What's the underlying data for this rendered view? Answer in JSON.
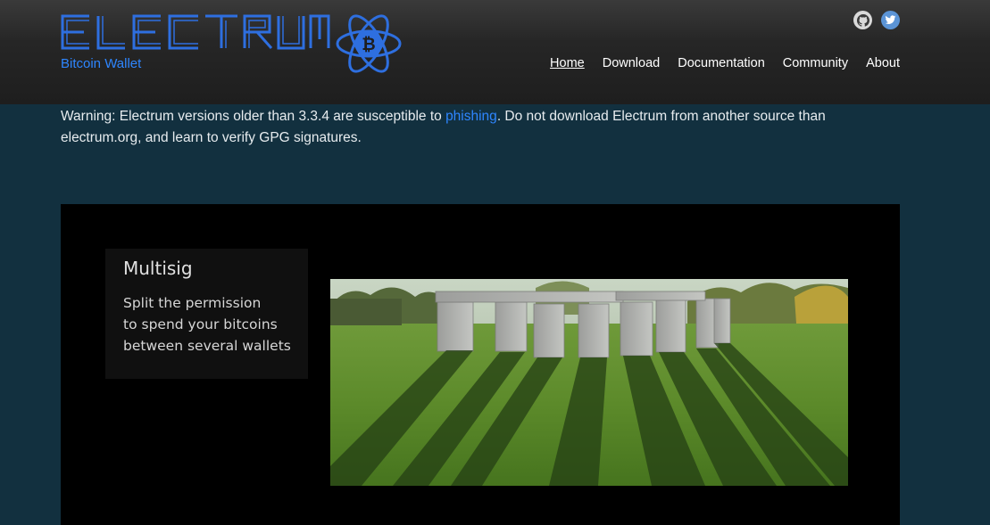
{
  "brand": {
    "tagline": "Bitcoin Wallet",
    "accent_color": "#2e86ff",
    "logo_icon": "bitcoin-atom-icon"
  },
  "social": {
    "github_icon": "github-icon",
    "twitter_icon": "twitter-icon"
  },
  "nav": {
    "items": [
      {
        "label": "Home"
      },
      {
        "label": "Download"
      },
      {
        "label": "Documentation"
      },
      {
        "label": "Community"
      },
      {
        "label": "About"
      }
    ]
  },
  "warning": {
    "before": "Warning: Electrum versions older than 3.3.4 are susceptible to ",
    "link": "phishing",
    "after": ". Do not download Electrum from another source than electrum.org, and learn to verify GPG signatures."
  },
  "feature": {
    "title": "Multisig",
    "lines": [
      "Split the permission",
      "to spend your bitcoins",
      "between several wallets"
    ]
  }
}
